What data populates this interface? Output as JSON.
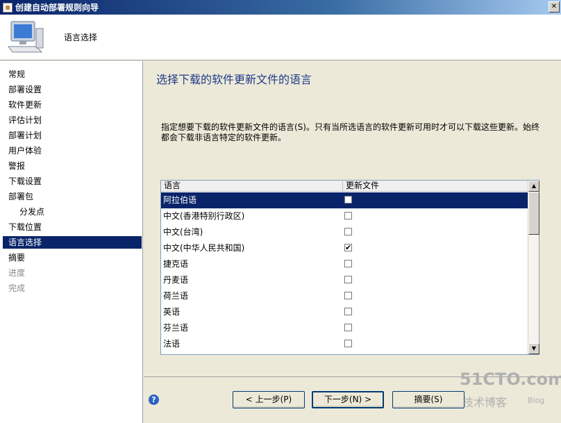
{
  "window": {
    "title": "创建自动部署规则向导",
    "close_glyph": "✕"
  },
  "header": {
    "title": "语言选择",
    "icon": "computer-icon"
  },
  "nav": {
    "items": [
      {
        "label": "常规",
        "state": "normal",
        "indent": false
      },
      {
        "label": "部署设置",
        "state": "normal",
        "indent": false
      },
      {
        "label": "软件更新",
        "state": "normal",
        "indent": false
      },
      {
        "label": "评估计划",
        "state": "normal",
        "indent": false
      },
      {
        "label": "部署计划",
        "state": "normal",
        "indent": false
      },
      {
        "label": "用户体验",
        "state": "normal",
        "indent": false
      },
      {
        "label": "警报",
        "state": "normal",
        "indent": false
      },
      {
        "label": "下载设置",
        "state": "normal",
        "indent": false
      },
      {
        "label": "部署包",
        "state": "normal",
        "indent": false
      },
      {
        "label": "分发点",
        "state": "normal",
        "indent": true
      },
      {
        "label": "下载位置",
        "state": "normal",
        "indent": false
      },
      {
        "label": "语言选择",
        "state": "selected",
        "indent": false
      },
      {
        "label": "摘要",
        "state": "normal",
        "indent": false
      },
      {
        "label": "进度",
        "state": "disabled",
        "indent": false
      },
      {
        "label": "完成",
        "state": "disabled",
        "indent": false
      }
    ]
  },
  "main": {
    "heading": "选择下载的软件更新文件的语言",
    "description": "指定想要下载的软件更新文件的语言(S)。只有当所选语言的软件更新可用时才可以下载这些更新。始终都会下载非语言特定的软件更新。",
    "grid": {
      "columns": [
        "语言",
        "更新文件"
      ],
      "rows": [
        {
          "language": "阿拉伯语",
          "checked": false,
          "selected": true
        },
        {
          "language": "中文(香港特别行政区)",
          "checked": false,
          "selected": false
        },
        {
          "language": "中文(台湾)",
          "checked": false,
          "selected": false
        },
        {
          "language": "中文(中华人民共和国)",
          "checked": true,
          "selected": false
        },
        {
          "language": "捷克语",
          "checked": false,
          "selected": false
        },
        {
          "language": "丹麦语",
          "checked": false,
          "selected": false
        },
        {
          "language": "荷兰语",
          "checked": false,
          "selected": false
        },
        {
          "language": "英语",
          "checked": false,
          "selected": false
        },
        {
          "language": "芬兰语",
          "checked": false,
          "selected": false
        },
        {
          "language": "法语",
          "checked": false,
          "selected": false
        }
      ],
      "check_glyph": "✔",
      "scroll_up_glyph": "▲",
      "scroll_down_glyph": "▼"
    }
  },
  "footer": {
    "help_glyph": "?",
    "back_label": "< 上一步(P)",
    "next_label": "下一步(N) >",
    "summary_label": "摘要(S)"
  },
  "watermark": {
    "line1": "51CTO.com",
    "line2": "技术博客",
    "line3": "Blog"
  }
}
